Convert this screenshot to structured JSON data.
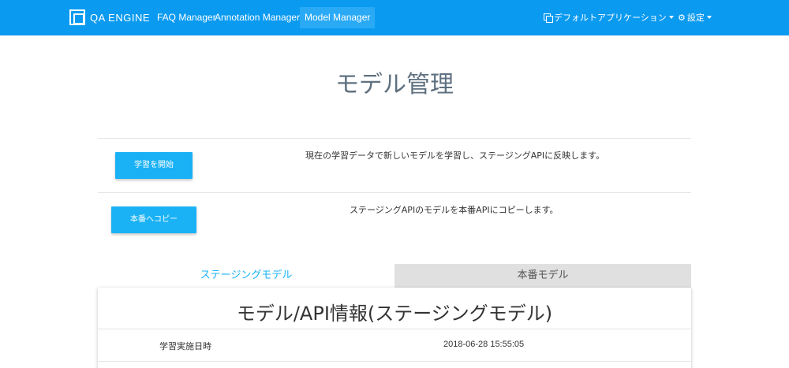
{
  "navbar": {
    "brand": "QA ENGINE",
    "items": [
      {
        "label": "FAQ Manager"
      },
      {
        "label": "Annotation Manager"
      },
      {
        "label": "Model Manager"
      }
    ],
    "app_selector": "デフォルトアプリケーション",
    "settings": "設定",
    "color": "#0a9af0"
  },
  "page": {
    "title": "モデル管理"
  },
  "actions": [
    {
      "button": "学習を開始",
      "description": "現在の学習データで新しいモデルを学習し、ステージングAPIに反映します。"
    },
    {
      "button": "本番へコピー",
      "description": "ステージングAPIのモデルを本番APIにコピーします。"
    }
  ],
  "tabs": [
    {
      "label": "ステージングモデル",
      "active": true
    },
    {
      "label": "本番モデル",
      "active": false
    }
  ],
  "panel": {
    "title": "モデル/API情報(ステージングモデル)",
    "rows": [
      {
        "label": "学習実施日時",
        "value": "2018-06-28 15:55:05"
      }
    ]
  },
  "colors": {
    "accent": "#1ab2f5",
    "title": "#5f7180",
    "inactive_tab": "#e0e0e0"
  },
  "icons": {
    "brand": "qa-engine-logo-icon",
    "app": "copy-icon",
    "settings": "gear-icon"
  }
}
